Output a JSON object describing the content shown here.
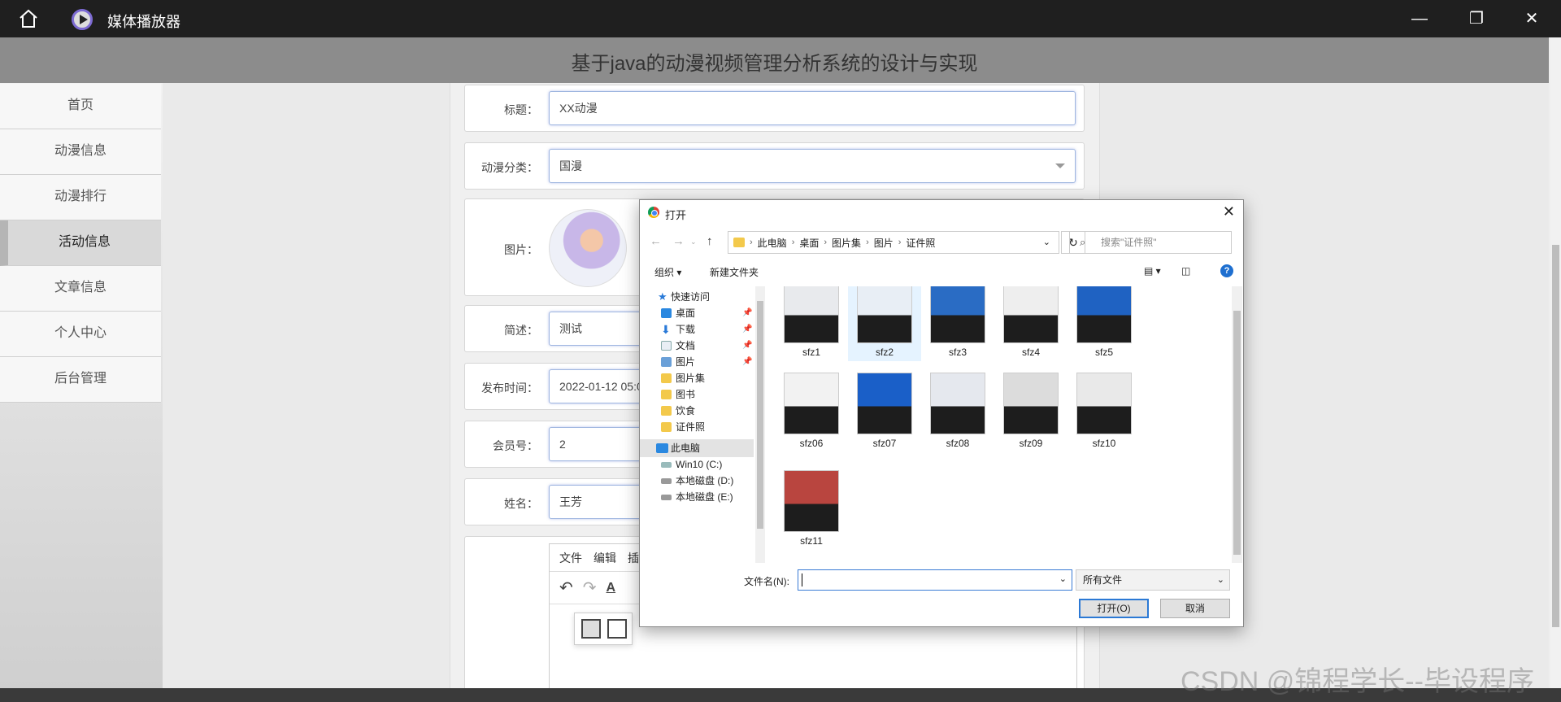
{
  "window": {
    "title": "媒体播放器",
    "controls": {
      "minimize": "—",
      "restore": "❐",
      "close": "✕"
    }
  },
  "app": {
    "header_title": "基于java的动漫视频管理分析系统的设计与实现"
  },
  "sidebar": {
    "items": [
      {
        "label": "首页"
      },
      {
        "label": "动漫信息"
      },
      {
        "label": "动漫排行"
      },
      {
        "label": "活动信息",
        "active": true
      },
      {
        "label": "文章信息"
      },
      {
        "label": "个人中心"
      },
      {
        "label": "后台管理"
      }
    ]
  },
  "form": {
    "title_label": "标题：",
    "title_value": "XX动漫",
    "category_label": "动漫分类：",
    "category_value": "国漫",
    "image_label": "图片：",
    "summary_label": "简述：",
    "summary_value": "测试",
    "publish_label": "发布时间：",
    "publish_value": "2022-01-12 05:0",
    "member_label": "会员号：",
    "member_value": "2",
    "name_label": "姓名：",
    "name_value": "王芳"
  },
  "editor": {
    "menu": [
      "文件",
      "编辑",
      "插"
    ],
    "tools": {
      "undo": "↶",
      "redo": "↷",
      "font_color": "A"
    }
  },
  "dialog": {
    "title": "打开",
    "close": "✕",
    "path": [
      "此电脑",
      "桌面",
      "图片集",
      "图片",
      "证件照"
    ],
    "search_placeholder": "搜索\"证件照\"",
    "toolbar": {
      "organize": "组织 ▾",
      "new_folder": "新建文件夹",
      "help": "?"
    },
    "nav": [
      {
        "label": "快速访问",
        "icon": "star-icon",
        "pinned": false
      },
      {
        "label": "桌面",
        "icon": "desktop-icon",
        "pinned": true
      },
      {
        "label": "下载",
        "icon": "download-icon",
        "pinned": true
      },
      {
        "label": "文档",
        "icon": "document-icon",
        "pinned": true
      },
      {
        "label": "图片",
        "icon": "pictures-icon",
        "pinned": true
      },
      {
        "label": "图片集",
        "icon": "folder-icon",
        "pinned": false
      },
      {
        "label": "图书",
        "icon": "folder-icon",
        "pinned": false
      },
      {
        "label": "饮食",
        "icon": "folder-icon",
        "pinned": false
      },
      {
        "label": "证件照",
        "icon": "folder-icon",
        "pinned": false
      },
      {
        "label": "此电脑",
        "icon": "computer-icon",
        "pinned": false
      },
      {
        "label": "Win10 (C:)",
        "icon": "drive-icon",
        "pinned": false
      },
      {
        "label": "本地磁盘 (D:)",
        "icon": "drive-icon",
        "pinned": false
      },
      {
        "label": "本地磁盘 (E:)",
        "icon": "drive-icon",
        "pinned": false
      }
    ],
    "files": [
      {
        "name": "sfz1",
        "bg": "#e8eaed"
      },
      {
        "name": "sfz2",
        "bg": "#e8eef5"
      },
      {
        "name": "sfz3",
        "bg": "#2a6cc4"
      },
      {
        "name": "sfz4",
        "bg": "#eeeeee"
      },
      {
        "name": "sfz5",
        "bg": "#1f62c2"
      },
      {
        "name": "sfz06",
        "bg": "#f2f2f2"
      },
      {
        "name": "sfz07",
        "bg": "#1a5fc8"
      },
      {
        "name": "sfz08",
        "bg": "#e5e8ee"
      },
      {
        "name": "sfz09",
        "bg": "#dcdcdc"
      },
      {
        "name": "sfz10",
        "bg": "#e9e9e9"
      },
      {
        "name": "sfz11",
        "bg": "#b9453f"
      }
    ],
    "filename_label": "文件名(N):",
    "filename_value": "",
    "filetype_value": "所有文件",
    "open_button": "打开(O)",
    "cancel_button": "取消"
  },
  "watermark": "CSDN @锦程学长--毕设程序"
}
